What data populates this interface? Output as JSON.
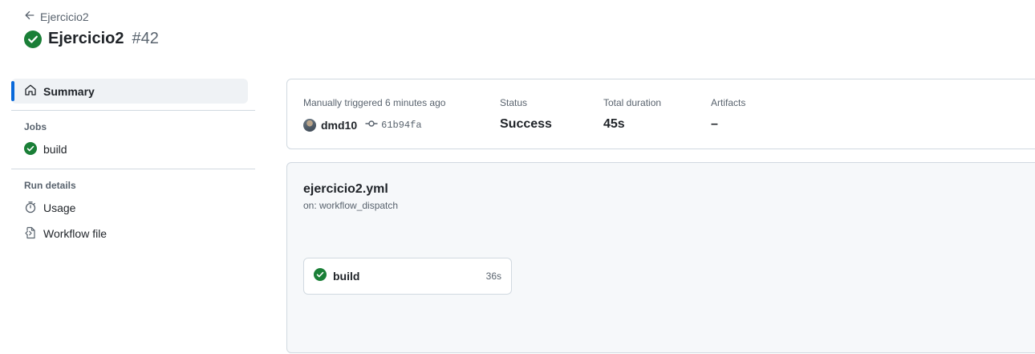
{
  "header": {
    "back_label": "Ejercicio2",
    "title": "Ejercicio2",
    "run_number": "#42",
    "status_icon": "check-circle-fill-icon"
  },
  "sidebar": {
    "summary_label": "Summary",
    "jobs_section": "Jobs",
    "jobs": [
      {
        "label": "build",
        "status": "success"
      }
    ],
    "run_details_section": "Run details",
    "usage_label": "Usage",
    "workflow_file_label": "Workflow file"
  },
  "summary": {
    "trigger_text": "Manually triggered 6 minutes ago",
    "actor": "dmd10",
    "commit": "61b94fa",
    "status_label": "Status",
    "status_value": "Success",
    "duration_label": "Total duration",
    "duration_value": "45s",
    "artifacts_label": "Artifacts",
    "artifacts_value": "–"
  },
  "workflow": {
    "file_name": "ejercicio2.yml",
    "trigger": "on: workflow_dispatch",
    "jobs": [
      {
        "name": "build",
        "duration": "36s",
        "status": "success"
      }
    ]
  },
  "colors": {
    "success": "#1a7f37",
    "accent": "#0969da",
    "muted_text": "#59636e",
    "border": "#d1d9e0",
    "panel_bg": "#f6f8fa"
  }
}
